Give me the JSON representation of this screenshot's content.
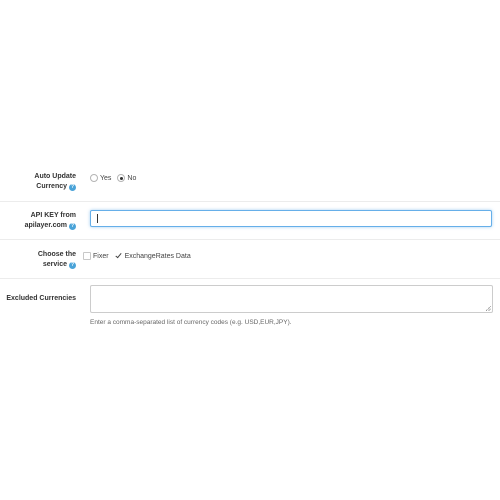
{
  "auto_update": {
    "label_line1": "Auto Update",
    "label_line2": "Currency",
    "help_icon": "question-circle-icon",
    "options": [
      {
        "label": "Yes",
        "checked": false
      },
      {
        "label": "No",
        "checked": true
      }
    ]
  },
  "api_key": {
    "label_line1": "API KEY from",
    "label_line2": "apilayer.com",
    "help_icon": "question-circle-icon",
    "value": ""
  },
  "service": {
    "label_line1": "Choose the",
    "label_line2": "service",
    "help_icon": "question-circle-icon",
    "options": [
      {
        "label": "Fixer",
        "checked": false
      },
      {
        "label": "ExchangeRates Data",
        "checked": true
      }
    ]
  },
  "excluded": {
    "label": "Excluded Currencies",
    "value": "",
    "help_text": "Enter a comma-separated list of currency codes (e.g. USD,EUR,JPY)."
  },
  "colors": {
    "help_icon": "#4aa3d8",
    "focus_border": "#66afe9"
  }
}
